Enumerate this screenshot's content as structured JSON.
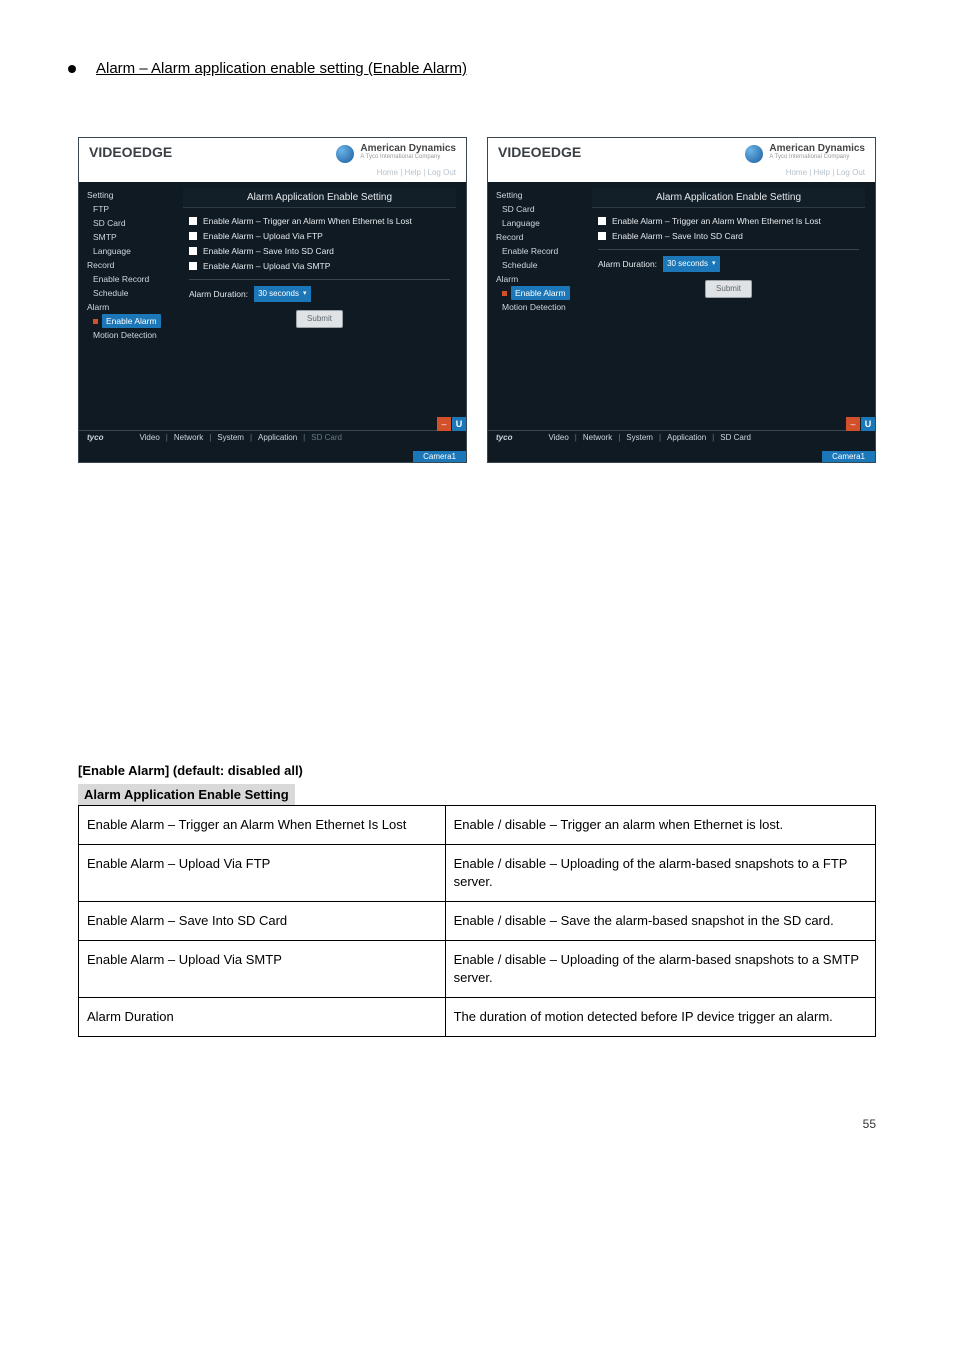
{
  "bullet_heading": "Alarm – Alarm application enable setting (Enable Alarm)",
  "shared": {
    "logo_left": "VIDEOEDGE",
    "brand": "American Dynamics",
    "brand_sub": "A Tyco International Company",
    "top_links": "Home   |   Help   |   Log Out",
    "panel_title": "Alarm Application Enable Setting",
    "cb1": "Enable Alarm – Trigger an Alarm When Ethernet Is Lost",
    "cb_ftp": "Enable Alarm – Upload Via FTP",
    "cb_sd": "Enable Alarm – Save Into SD Card",
    "cb_smtp": "Enable Alarm – Upload Via SMTP",
    "ad_label": "Alarm Duration:",
    "ad_value": "30 seconds",
    "submit": "Submit",
    "tyco": "tyco",
    "tabs": [
      "Video",
      "Network",
      "System",
      "Application",
      "SD Card"
    ],
    "camera": "Camera1",
    "corner_u": "U"
  },
  "navA": {
    "setting": "Setting",
    "ftp": "FTP",
    "sd": "SD Card",
    "smtp": "SMTP",
    "lang": "Language",
    "record": "Record",
    "enable_rec": "Enable Record",
    "schedule": "Schedule",
    "alarm": "Alarm",
    "enable_alarm": "Enable Alarm",
    "motion": "Motion Detection"
  },
  "navB": {
    "setting": "Setting",
    "sd": "SD Card",
    "lang": "Language",
    "record": "Record",
    "enable_rec": "Enable Record",
    "schedule": "Schedule",
    "alarm": "Alarm",
    "enable_alarm": "Enable Alarm",
    "motion": "Motion Detection"
  },
  "table_title": "[Enable Alarm] (default: disabled all)",
  "hdr1": "Alarm Application Enable Setting",
  "rows": [
    [
      "Enable Alarm – Trigger an Alarm When Ethernet Is Lost",
      "Enable / disable – Trigger an alarm when Ethernet is lost."
    ],
    [
      "Enable Alarm – Upload Via FTP",
      "Enable / disable – Uploading of the alarm-based snapshots to a FTP server."
    ],
    [
      "Enable Alarm – Save Into SD Card",
      "Enable / disable – Save the alarm-based snapshot in the SD card."
    ],
    [
      "Enable Alarm – Upload Via SMTP",
      "Enable / disable – Uploading of the alarm-based snapshots to a SMTP server."
    ],
    [
      "Alarm Duration",
      "The duration of motion detected before IP device trigger an alarm."
    ]
  ],
  "page_num": "55"
}
